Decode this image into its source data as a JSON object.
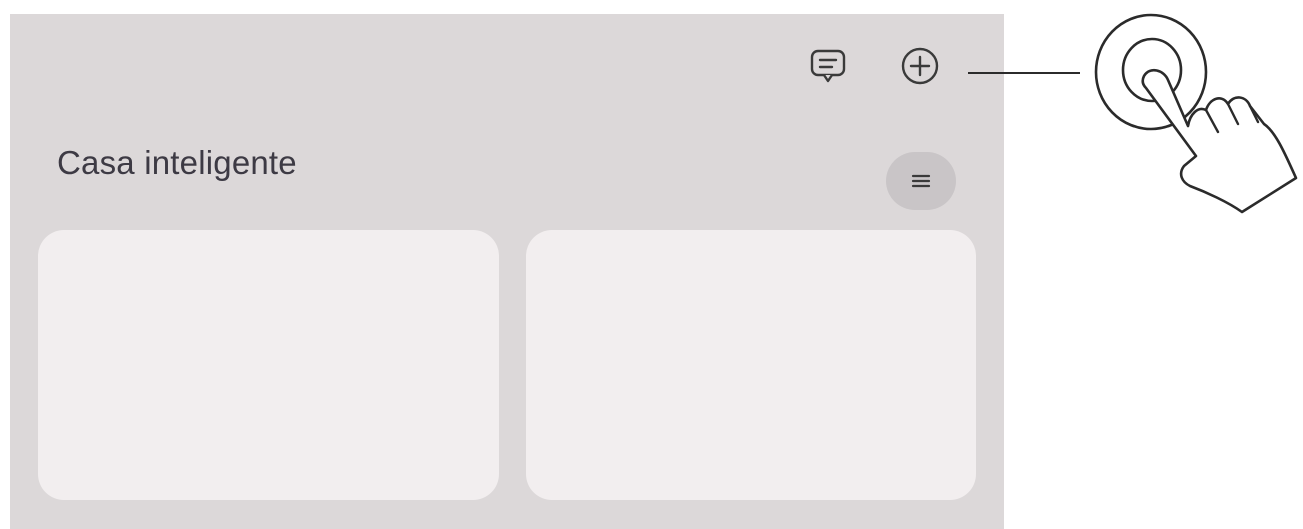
{
  "header": {
    "messages_icon": "message-square-icon",
    "add_icon": "plus-circle-icon"
  },
  "main": {
    "title": "Casa inteligente",
    "menu_icon": "list-icon",
    "cards": [
      {
        "label": ""
      },
      {
        "label": ""
      }
    ]
  },
  "annotation": {
    "gesture": "tap-hand-icon",
    "target": "add"
  },
  "colors": {
    "panel_bg": "#dcd8d9",
    "card_bg": "#f2eeef",
    "menu_bg": "#c9c5c7",
    "title_text": "#3d3a44"
  }
}
